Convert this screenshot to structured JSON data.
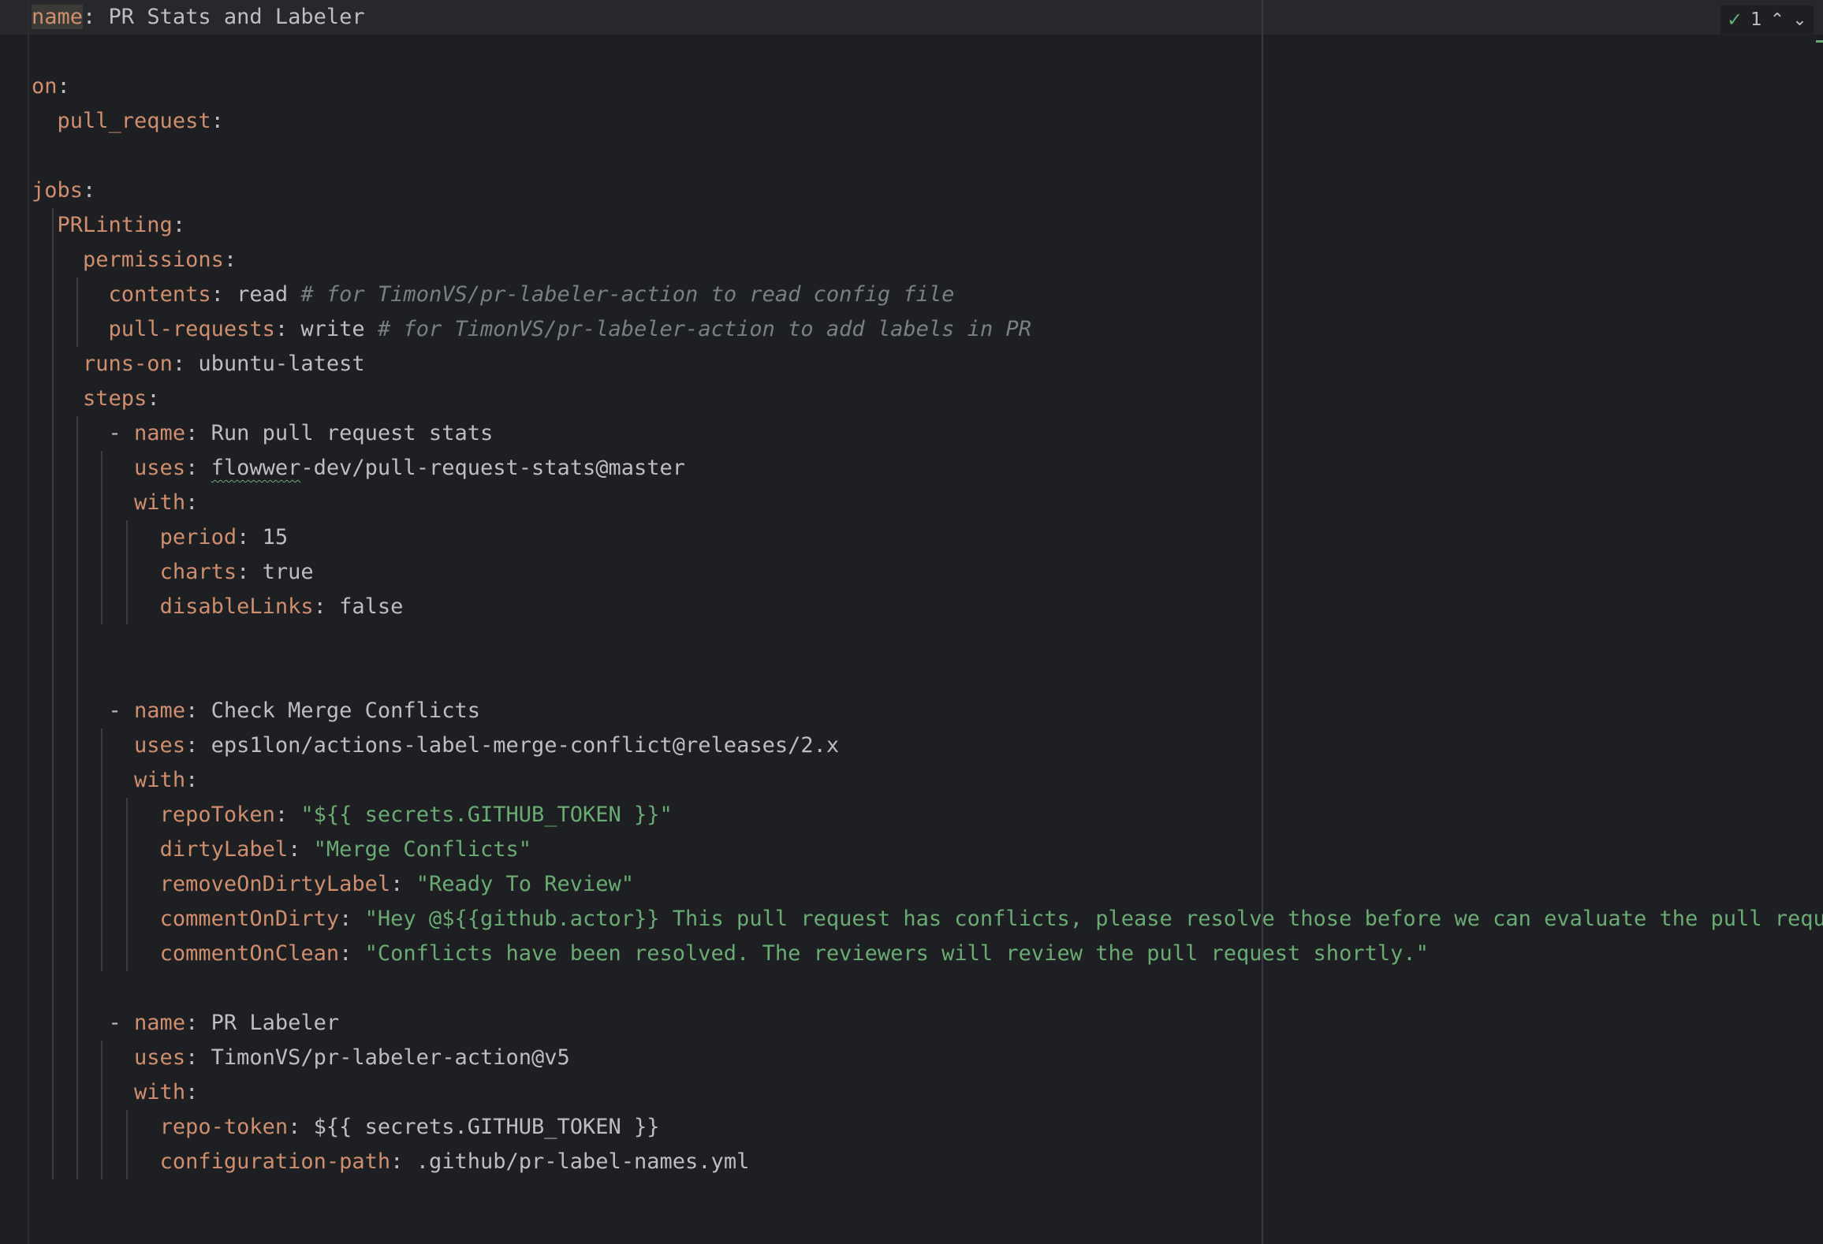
{
  "editor": {
    "language": "yaml",
    "colors": {
      "background": "#1e1f22",
      "header_band": "#26282c",
      "key": "#cf8e6d",
      "value": "#bcbec4",
      "string": "#6aab73",
      "comment": "#7a7e85"
    },
    "lines": [
      {
        "tokens": [
          {
            "t": "k",
            "v": "name",
            "hl": true
          },
          {
            "t": "p",
            "v": ": "
          },
          {
            "t": "v",
            "v": "PR Stats and Labeler"
          }
        ]
      },
      {
        "tokens": []
      },
      {
        "tokens": [
          {
            "t": "k",
            "v": "on"
          },
          {
            "t": "p",
            "v": ":"
          }
        ]
      },
      {
        "tokens": [
          {
            "t": "p",
            "v": "  "
          },
          {
            "t": "k",
            "v": "pull_request"
          },
          {
            "t": "p",
            "v": ":"
          }
        ]
      },
      {
        "tokens": []
      },
      {
        "tokens": [
          {
            "t": "k",
            "v": "jobs"
          },
          {
            "t": "p",
            "v": ":"
          }
        ]
      },
      {
        "tokens": [
          {
            "t": "p",
            "v": "  "
          },
          {
            "t": "k",
            "v": "PRLinting"
          },
          {
            "t": "p",
            "v": ":"
          }
        ]
      },
      {
        "tokens": [
          {
            "t": "p",
            "v": "    "
          },
          {
            "t": "k",
            "v": "permissions"
          },
          {
            "t": "p",
            "v": ":"
          }
        ]
      },
      {
        "tokens": [
          {
            "t": "p",
            "v": "      "
          },
          {
            "t": "k",
            "v": "contents"
          },
          {
            "t": "p",
            "v": ": "
          },
          {
            "t": "v",
            "v": "read "
          },
          {
            "t": "c",
            "v": "# for TimonVS/pr-labeler-action to read config file"
          }
        ]
      },
      {
        "tokens": [
          {
            "t": "p",
            "v": "      "
          },
          {
            "t": "k",
            "v": "pull-requests"
          },
          {
            "t": "p",
            "v": ": "
          },
          {
            "t": "v",
            "v": "write "
          },
          {
            "t": "c",
            "v": "# for TimonVS/pr-labeler-action to add labels in PR"
          }
        ]
      },
      {
        "tokens": [
          {
            "t": "p",
            "v": "    "
          },
          {
            "t": "k",
            "v": "runs-on"
          },
          {
            "t": "p",
            "v": ": "
          },
          {
            "t": "v",
            "v": "ubuntu-latest"
          }
        ]
      },
      {
        "tokens": [
          {
            "t": "p",
            "v": "    "
          },
          {
            "t": "k",
            "v": "steps"
          },
          {
            "t": "p",
            "v": ":"
          }
        ]
      },
      {
        "tokens": [
          {
            "t": "p",
            "v": "      - "
          },
          {
            "t": "k",
            "v": "name"
          },
          {
            "t": "p",
            "v": ": "
          },
          {
            "t": "v",
            "v": "Run pull request stats"
          }
        ]
      },
      {
        "tokens": [
          {
            "t": "p",
            "v": "        "
          },
          {
            "t": "k",
            "v": "uses"
          },
          {
            "t": "p",
            "v": ": "
          },
          {
            "t": "v",
            "v": "flowwer",
            "squig": true
          },
          {
            "t": "v",
            "v": "-dev/pull-request-stats@master"
          }
        ]
      },
      {
        "tokens": [
          {
            "t": "p",
            "v": "        "
          },
          {
            "t": "k",
            "v": "with"
          },
          {
            "t": "p",
            "v": ":"
          }
        ]
      },
      {
        "tokens": [
          {
            "t": "p",
            "v": "          "
          },
          {
            "t": "k",
            "v": "period"
          },
          {
            "t": "p",
            "v": ": "
          },
          {
            "t": "v",
            "v": "15"
          }
        ]
      },
      {
        "tokens": [
          {
            "t": "p",
            "v": "          "
          },
          {
            "t": "k",
            "v": "charts"
          },
          {
            "t": "p",
            "v": ": "
          },
          {
            "t": "v",
            "v": "true"
          }
        ]
      },
      {
        "tokens": [
          {
            "t": "p",
            "v": "          "
          },
          {
            "t": "k",
            "v": "disableLinks"
          },
          {
            "t": "p",
            "v": ": "
          },
          {
            "t": "v",
            "v": "false"
          }
        ]
      },
      {
        "tokens": []
      },
      {
        "tokens": []
      },
      {
        "tokens": [
          {
            "t": "p",
            "v": "      - "
          },
          {
            "t": "k",
            "v": "name"
          },
          {
            "t": "p",
            "v": ": "
          },
          {
            "t": "v",
            "v": "Check Merge Conflicts"
          }
        ]
      },
      {
        "tokens": [
          {
            "t": "p",
            "v": "        "
          },
          {
            "t": "k",
            "v": "uses"
          },
          {
            "t": "p",
            "v": ": "
          },
          {
            "t": "v",
            "v": "eps1lon/actions-label-merge-conflict@releases/2.x"
          }
        ]
      },
      {
        "tokens": [
          {
            "t": "p",
            "v": "        "
          },
          {
            "t": "k",
            "v": "with"
          },
          {
            "t": "p",
            "v": ":"
          }
        ]
      },
      {
        "tokens": [
          {
            "t": "p",
            "v": "          "
          },
          {
            "t": "k",
            "v": "repoToken"
          },
          {
            "t": "p",
            "v": ": "
          },
          {
            "t": "s",
            "v": "\"${{ secrets.GITHUB_TOKEN }}\""
          }
        ]
      },
      {
        "tokens": [
          {
            "t": "p",
            "v": "          "
          },
          {
            "t": "k",
            "v": "dirtyLabel"
          },
          {
            "t": "p",
            "v": ": "
          },
          {
            "t": "s",
            "v": "\"Merge Conflicts\""
          }
        ]
      },
      {
        "tokens": [
          {
            "t": "p",
            "v": "          "
          },
          {
            "t": "k",
            "v": "removeOnDirtyLabel"
          },
          {
            "t": "p",
            "v": ": "
          },
          {
            "t": "s",
            "v": "\"Ready To Review\""
          }
        ]
      },
      {
        "tokens": [
          {
            "t": "p",
            "v": "          "
          },
          {
            "t": "k",
            "v": "commentOnDirty"
          },
          {
            "t": "p",
            "v": ": "
          },
          {
            "t": "s",
            "v": "\"Hey @${{github.actor}} This pull request has conflicts, please resolve those before we can evaluate the pull request.\""
          }
        ]
      },
      {
        "tokens": [
          {
            "t": "p",
            "v": "          "
          },
          {
            "t": "k",
            "v": "commentOnClean"
          },
          {
            "t": "p",
            "v": ": "
          },
          {
            "t": "s",
            "v": "\"Conflicts have been resolved. The reviewers will review the pull request shortly.\""
          }
        ]
      },
      {
        "tokens": []
      },
      {
        "tokens": [
          {
            "t": "p",
            "v": "      - "
          },
          {
            "t": "k",
            "v": "name"
          },
          {
            "t": "p",
            "v": ": "
          },
          {
            "t": "v",
            "v": "PR Labeler"
          }
        ]
      },
      {
        "tokens": [
          {
            "t": "p",
            "v": "        "
          },
          {
            "t": "k",
            "v": "uses"
          },
          {
            "t": "p",
            "v": ": "
          },
          {
            "t": "v",
            "v": "TimonVS/pr-labeler-action@v5"
          }
        ]
      },
      {
        "tokens": [
          {
            "t": "p",
            "v": "        "
          },
          {
            "t": "k",
            "v": "with"
          },
          {
            "t": "p",
            "v": ":"
          }
        ]
      },
      {
        "tokens": [
          {
            "t": "p",
            "v": "          "
          },
          {
            "t": "k",
            "v": "repo-token"
          },
          {
            "t": "p",
            "v": ": "
          },
          {
            "t": "v",
            "v": "${{ secrets.GITHUB_TOKEN }}"
          }
        ]
      },
      {
        "tokens": [
          {
            "t": "p",
            "v": "          "
          },
          {
            "t": "k",
            "v": "configuration-path"
          },
          {
            "t": "p",
            "v": ": "
          },
          {
            "t": "v",
            "v": ".github/pr-label-names.yml"
          }
        ]
      }
    ]
  },
  "inspection_widget": {
    "status_icon": "check-icon",
    "count": "1",
    "prev_icon": "chevron-up-icon",
    "next_icon": "chevron-down-icon"
  }
}
